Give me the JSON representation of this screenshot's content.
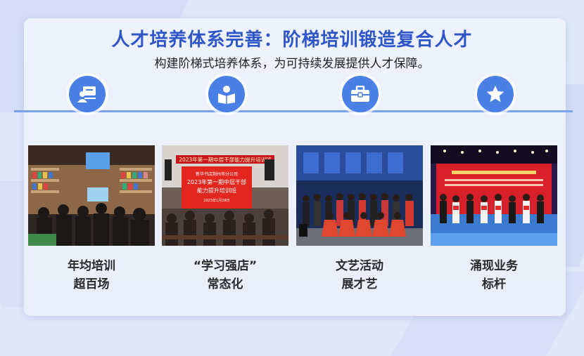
{
  "header": {
    "title": "人才培养体系完善：阶梯培训锻造复合人才",
    "subtitle": "构建阶梯式培养体系，为可持续发展提供人才保障。"
  },
  "colors": {
    "accent": "#2f56c8",
    "icon_bg": "#4a80e6",
    "divider": "#7aa1ec"
  },
  "cards": [
    {
      "icon": "teacher-board-icon",
      "caption_line1": "年均培训",
      "caption_line2": "超百场"
    },
    {
      "icon": "reading-book-icon",
      "caption_line1": "“学习强店”",
      "caption_line2": "常态化",
      "photo_text": {
        "banner": "2023年第一期中层干部能力提升培训班",
        "screen_line1": "新华书店荆州市分公司",
        "screen_line2": "2023年第一期中层干部",
        "screen_line3": "能力提升培训班",
        "screen_date": "2023年1月28日"
      }
    },
    {
      "icon": "briefcase-icon",
      "caption_line1": "文艺活动",
      "caption_line2": "展才艺"
    },
    {
      "icon": "star-icon",
      "caption_line1": "涌现业务",
      "caption_line2": "标杆"
    }
  ]
}
